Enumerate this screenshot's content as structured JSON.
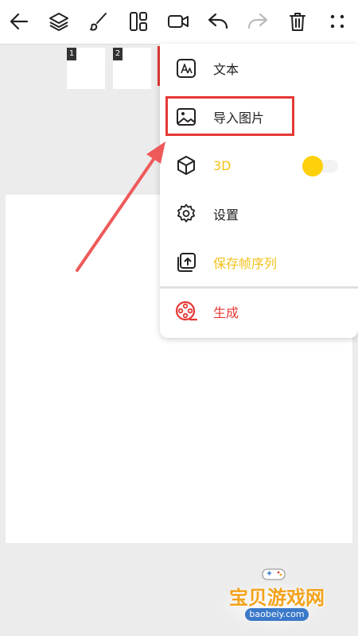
{
  "toolbar": {
    "icons": [
      "back-icon",
      "layers-icon",
      "brush-icon",
      "layout-icon",
      "camera-icon",
      "undo-icon",
      "redo-icon",
      "trash-icon",
      "more-icon"
    ]
  },
  "frames": [
    {
      "number": "1"
    },
    {
      "number": "2"
    }
  ],
  "menu": {
    "items": [
      {
        "label": "文本",
        "icon": "text-icon",
        "color": "#222222"
      },
      {
        "label": "导入图片",
        "icon": "image-icon",
        "color": "#222222"
      },
      {
        "label": "3D",
        "icon": "cube-icon",
        "color": "#f2c21a"
      },
      {
        "label": "设置",
        "icon": "gear-icon",
        "color": "#222222"
      },
      {
        "label": "保存帧序列",
        "icon": "export-icon",
        "color": "#f2c21a"
      },
      {
        "label": "生成",
        "icon": "film-reel-icon",
        "color": "#e53935"
      }
    ],
    "toggle_3d": {
      "on": true,
      "knob_color": "#fdd00c"
    }
  },
  "colors": {
    "accent_red": "#e53935",
    "accent_yellow": "#f2c21a",
    "background": "#ececec"
  },
  "watermark": {
    "title": "宝贝游戏网",
    "url": "baobeiy.com"
  }
}
